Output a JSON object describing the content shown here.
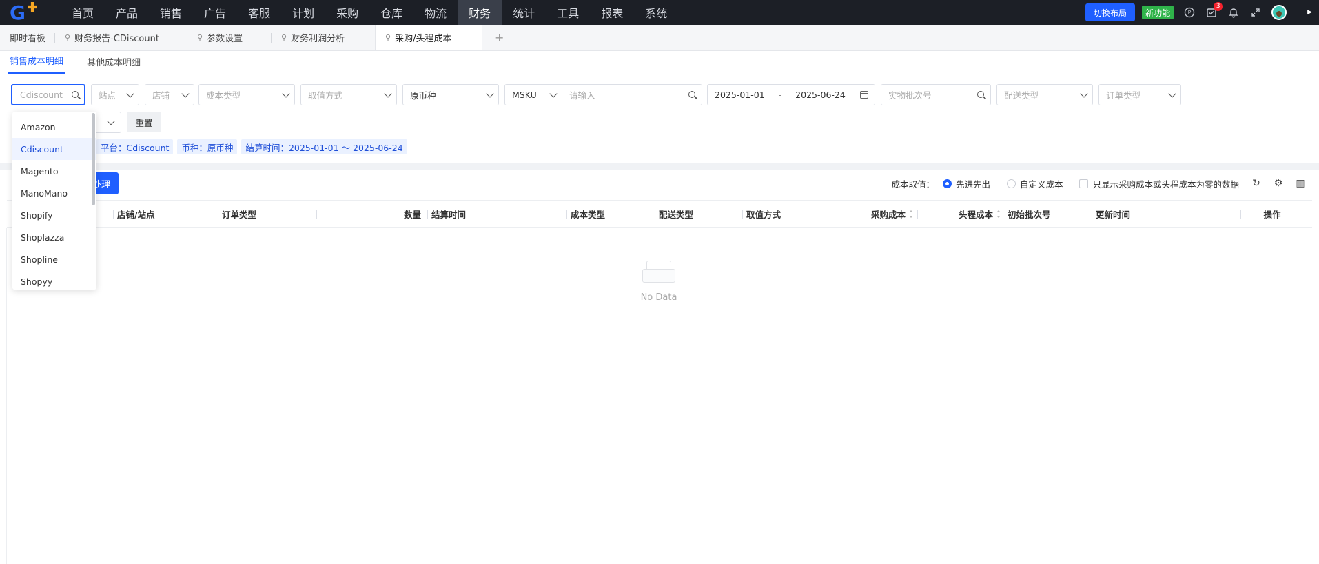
{
  "nav": {
    "items": [
      "首页",
      "产品",
      "销售",
      "广告",
      "客服",
      "计划",
      "采购",
      "仓库",
      "物流",
      "财务",
      "统计",
      "工具",
      "报表",
      "系统"
    ],
    "active_index": 9,
    "switch_layout": "切换布局",
    "new_feature": "新功能",
    "notif_count": "3",
    "icons": [
      "help-icon",
      "task-icon",
      "bell-icon",
      "fullscreen-icon",
      "avatar",
      "caret-right-icon"
    ]
  },
  "tabs": {
    "home": "即时看板",
    "items": [
      "财务报告-CDiscount",
      "参数设置",
      "财务利润分析",
      "采购/头程成本"
    ],
    "active_index": 3,
    "add": "+"
  },
  "subtabs": [
    "销售成本明细",
    "其他成本明细"
  ],
  "filters": {
    "platform": "Cdiscount",
    "site": "站点",
    "shop": "店铺",
    "cost_type": "成本类型",
    "value_method": "取值方式",
    "currency": "原币种",
    "sku_type": "MSKU",
    "sku_placeholder": "请输入",
    "date_start": "2025-01-01",
    "date_sep": "-",
    "date_end": "2025-06-24",
    "batch_placeholder": "实物批次号",
    "delivery_type": "配送类型",
    "order_type": "订单类型",
    "reset": "重置"
  },
  "tags": [
    "平台：Cdiscount",
    "币种：原币种",
    "结算时间：2025-01-01 ～ 2025-06-24"
  ],
  "toolbar": {
    "process_btn": "处理",
    "cost_label": "成本取值：",
    "radio1": "先进先出",
    "radio2": "自定义成本",
    "checkbox": "只显示采购成本或头程成本为零的数据"
  },
  "table": {
    "columns": [
      "店铺/站点",
      "订单类型",
      "数量",
      "结算时间",
      "成本类型",
      "配送类型",
      "取值方式",
      "采购成本",
      "头程成本",
      "初始批次号",
      "更新时间",
      "操作"
    ],
    "empty_text": "No Data"
  },
  "dropdown": {
    "options": [
      "Amazon",
      "Cdiscount",
      "Magento",
      "ManoMano",
      "Shopify",
      "Shoplazza",
      "Shopline",
      "Shopyy"
    ],
    "selected_index": 1
  },
  "colors": {
    "primary": "#1f5fff",
    "nav_bg": "#1c1f26",
    "new_badge": "#2fb34a"
  }
}
